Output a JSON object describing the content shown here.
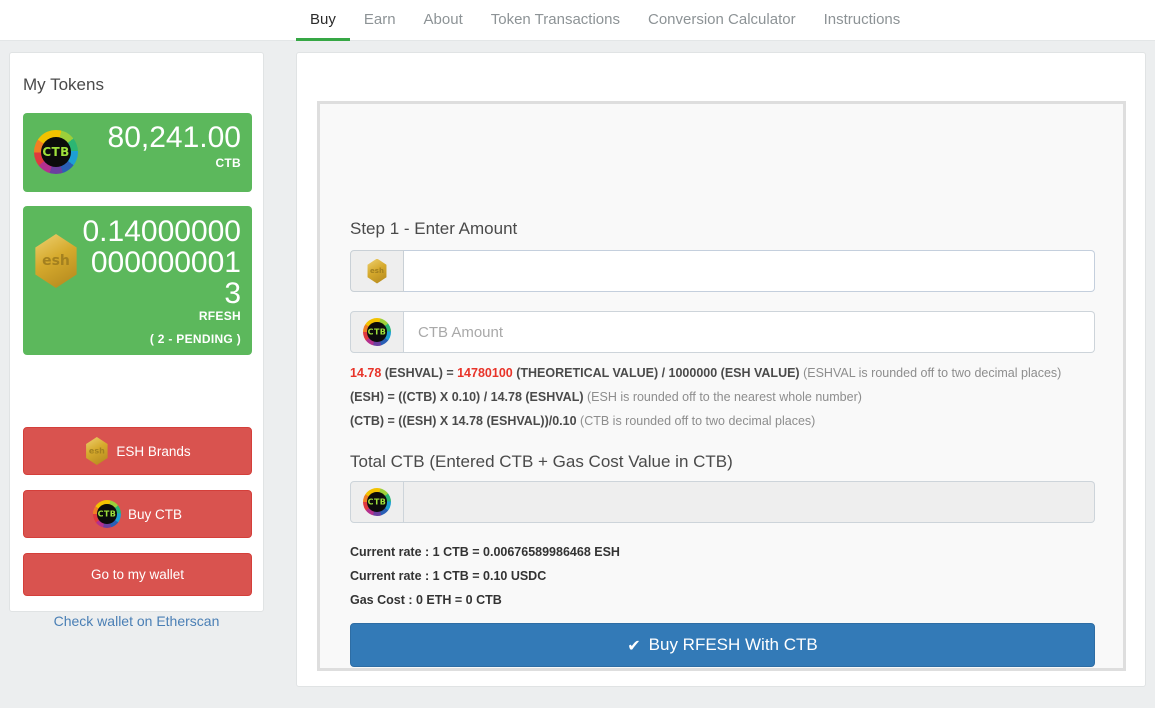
{
  "nav": {
    "tabs": [
      {
        "label": "Buy",
        "active": true
      },
      {
        "label": "Earn",
        "active": false
      },
      {
        "label": "About",
        "active": false
      },
      {
        "label": "Token Transactions",
        "active": false
      },
      {
        "label": "Conversion Calculator",
        "active": false
      },
      {
        "label": "Instructions",
        "active": false
      }
    ],
    "active_indicator_color": "#36a745"
  },
  "sidebar": {
    "title": "My Tokens",
    "token_cards": [
      {
        "icon": "ctb-coin-icon",
        "icon_label": "CTB",
        "amount": "80,241.00",
        "symbol": "CTB",
        "status": "",
        "background_color": "#5cb85c"
      },
      {
        "icon": "esh-hexagon-icon",
        "icon_label": "esh",
        "amount": "0.140000000000000013",
        "symbol": "RFESH",
        "status": "( 2 - PENDING )",
        "background_color": "#5cb85c"
      }
    ],
    "buttons": [
      {
        "label": "ESH Brands",
        "icon": "esh-hexagon-icon",
        "icon_label": "esh",
        "color": "#d9534f"
      },
      {
        "label": "Buy CTB",
        "icon": "ctb-coin-icon",
        "icon_label": "CTB",
        "color": "#d9534f"
      },
      {
        "label": "Go to my wallet",
        "icon": "",
        "icon_label": "",
        "color": "#d9534f"
      }
    ],
    "link": {
      "label": "Check wallet on Etherscan",
      "color": "#4a7fb5"
    }
  },
  "main": {
    "step1": {
      "title": "Step 1 - Enter Amount",
      "esh_input": {
        "value": "",
        "placeholder": "",
        "icon": "esh-hexagon-icon",
        "icon_label": "esh"
      },
      "ctb_input": {
        "value": "",
        "placeholder": "CTB Amount",
        "icon": "ctb-coin-icon",
        "icon_label": "CTB"
      }
    },
    "formulas": [
      {
        "hl_1": "14.78",
        "bold_1": " (ESHVAL) = ",
        "hl_2": "14780100",
        "bold_2": " (THEORETICAL VALUE) / 1000000 (ESH VALUE) ",
        "note": "(ESHVAL is rounded off to two decimal places)"
      },
      {
        "bold": "(ESH) = ((CTB) X 0.10) / 14.78 (ESHVAL) ",
        "note": "(ESH is rounded off to the nearest whole number)"
      },
      {
        "bold": "(CTB) = ((ESH) X 14.78 (ESHVAL))/0.10 ",
        "note": "(CTB is rounded off to two decimal places)"
      }
    ],
    "total": {
      "title": "Total CTB (Entered CTB + Gas Cost Value in CTB)",
      "input": {
        "value": "",
        "placeholder": "",
        "disabled": true,
        "icon": "ctb-coin-icon",
        "icon_label": "CTB"
      }
    },
    "rates": [
      "Current rate : 1 CTB = 0.00676589986468 ESH",
      "Current rate : 1 CTB = 0.10 USDC",
      "Gas Cost : 0 ETH = 0 CTB"
    ],
    "buy_button": {
      "label": "Buy RFESH With CTB",
      "icon": "check-icon",
      "glyph": "✔",
      "color": "#337ab7"
    }
  }
}
